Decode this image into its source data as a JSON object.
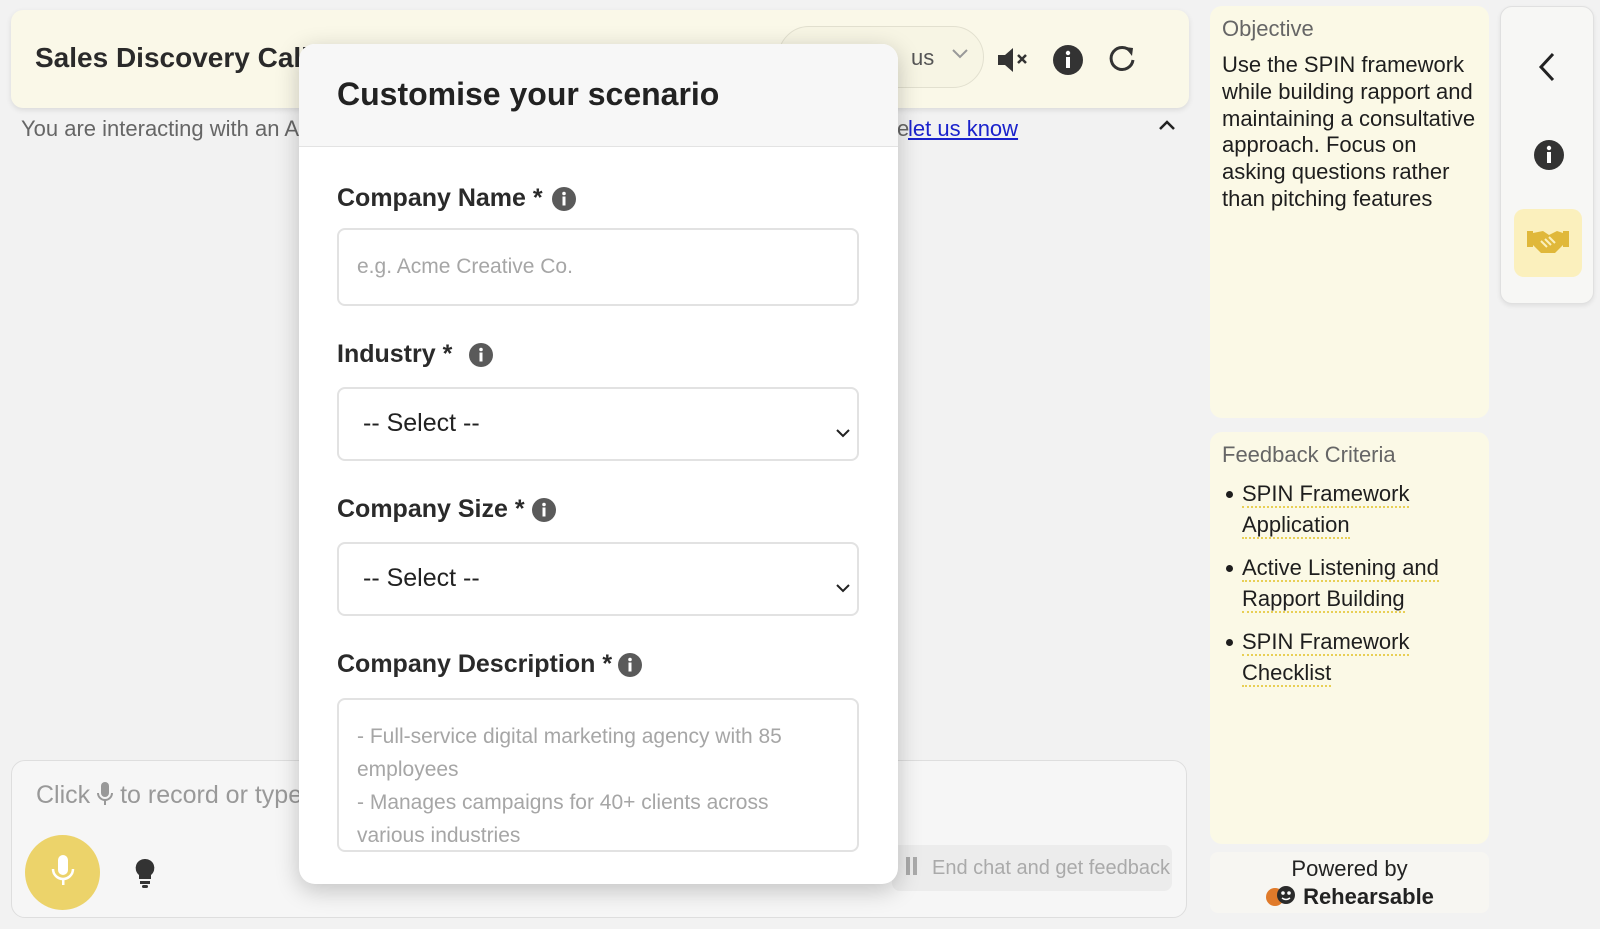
{
  "header": {
    "title": "Sales Discovery Call",
    "persona_partial": "us",
    "mute_label": "mute",
    "info_label": "info",
    "restart_label": "restart"
  },
  "banner": {
    "text_partial": "You are interacting with an A",
    "link_prefix": "e",
    "link_text": "let us know"
  },
  "composer": {
    "placeholder_before": "Click",
    "placeholder_after": "to record or type"
  },
  "actions": {
    "end_chat_label": "End chat and get feedback"
  },
  "objective": {
    "title": "Objective",
    "text": "Use the SPIN framework while building rapport and maintaining a consultative approach. Focus on asking questions rather than pitching features"
  },
  "feedback": {
    "title": "Feedback Criteria",
    "items": [
      {
        "label": "SPIN Framework Application"
      },
      {
        "label": "Active Listening and Rapport Building"
      },
      {
        "label": "SPIN Framework Checklist"
      }
    ]
  },
  "footer": {
    "powered_by": "Powered by",
    "brand": "Rehearsable"
  },
  "modal": {
    "title": "Customise your scenario",
    "company_name": {
      "label": "Company Name *",
      "placeholder": "e.g. Acme Creative Co."
    },
    "industry": {
      "label": "Industry *",
      "selected": "-- Select --"
    },
    "company_size": {
      "label": "Company Size *",
      "selected": "-- Select --"
    },
    "company_description": {
      "label": "Company Description *",
      "placeholder_line1": "- Full-service digital marketing agency with 85 employees",
      "placeholder_line2": "- Manages campaigns for 40+ clients across various industries"
    }
  },
  "colors": {
    "accent_yellow": "#ecd36a",
    "panel_bg": "#fbf9e6",
    "link_blue": "#1a22cc"
  },
  "icons": {
    "mute": "speaker-mute-icon",
    "info": "info-icon",
    "restart": "refresh-icon",
    "mic": "microphone-icon",
    "hint": "lightbulb-icon",
    "back": "chevron-left-icon",
    "roleplay": "handshake-icon"
  }
}
